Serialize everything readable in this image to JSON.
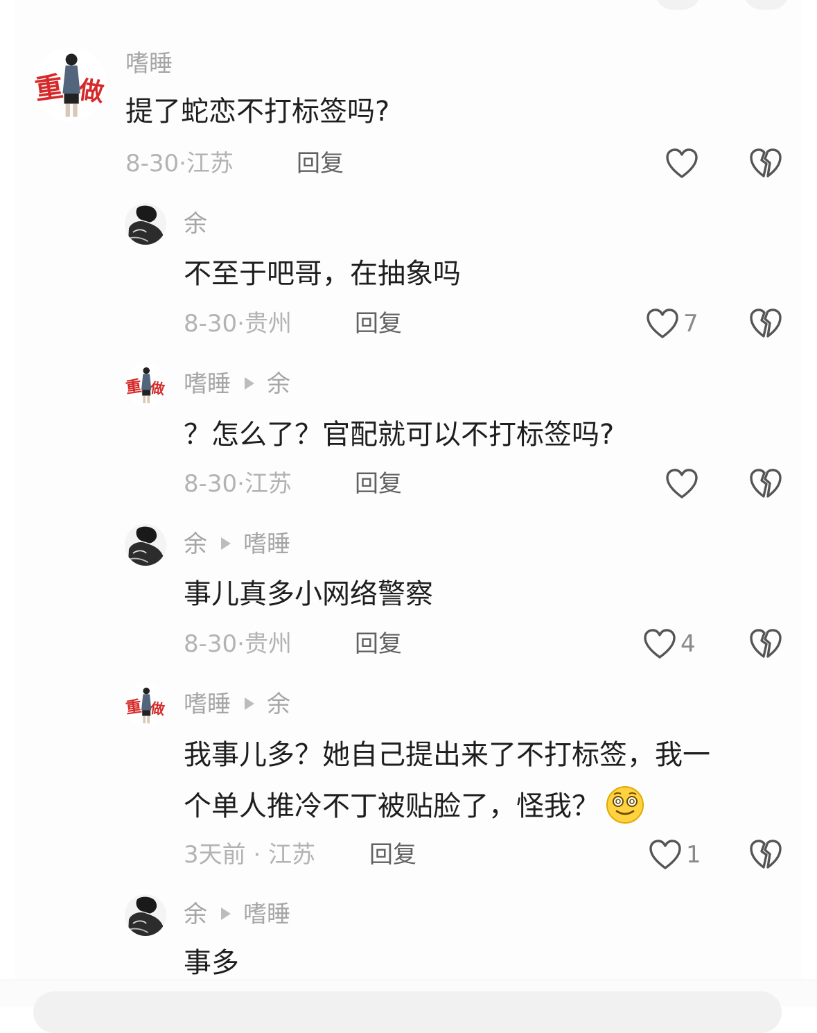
{
  "comments": [
    {
      "author": "嗜睡",
      "text": "提了蛇恋不打标签吗?",
      "date": "8-30",
      "location": "江苏",
      "reply_label": "回复",
      "likes": "",
      "avatar": "red-stamp"
    },
    {
      "author": "余",
      "text": "不至于吧哥，在抽象吗",
      "date": "8-30",
      "location": "贵州",
      "reply_label": "回复",
      "likes": "7",
      "avatar": "mono"
    },
    {
      "author": "嗜睡",
      "reply_to": "余",
      "text": "？怎么了？官配就可以不打标签吗?",
      "date": "8-30",
      "location": "江苏",
      "reply_label": "回复",
      "likes": "",
      "avatar": "red-stamp"
    },
    {
      "author": "余",
      "reply_to": "嗜睡",
      "text": "事儿真多小网络警察",
      "date": "8-30",
      "location": "贵州",
      "reply_label": "回复",
      "likes": "4",
      "avatar": "mono"
    },
    {
      "author": "嗜睡",
      "reply_to": "余",
      "text_line1": "我事儿多？她自己提出来了不打标签，我一",
      "text_line2": "个单人推冷不丁被贴脸了，怪我？",
      "date": "3天前",
      "location": "江苏",
      "reply_label": "回复",
      "likes": "1",
      "avatar": "red-stamp"
    },
    {
      "author": "余",
      "reply_to": "嗜睡",
      "text": "事多",
      "avatar": "mono"
    }
  ],
  "icons": {
    "like": "heart-outline-icon",
    "dislike": "broken-heart-icon",
    "emoji": "dizzy-smile-emoji-icon"
  },
  "colors": {
    "name": "#a6a6a6",
    "text": "#1e1e1e",
    "meta": "#b3b3b3",
    "reply": "#616161",
    "icon": "#555555"
  }
}
